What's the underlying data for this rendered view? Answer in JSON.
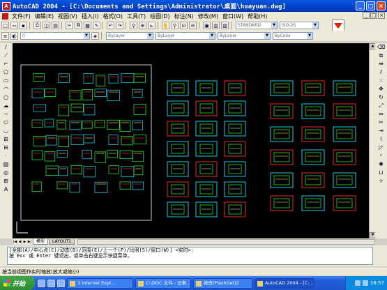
{
  "window": {
    "title": "AutoCAD 2004 - [C:\\Documents and Settings\\Administrator\\桌面\\huayuan.dwg]",
    "app_icon_text": "A",
    "buttons": [
      "_",
      "□",
      "×"
    ]
  },
  "menu": {
    "items": [
      "文件(F)",
      "编辑(E)",
      "视图(V)",
      "插入(I)",
      "格式(O)",
      "工具(T)",
      "绘图(D)",
      "标注(N)",
      "修改(M)",
      "窗口(W)",
      "帮助(H)"
    ],
    "mdi_buttons": [
      "_",
      "□",
      "×"
    ]
  },
  "toolbar": {
    "layer_combo": "0",
    "linetype_combo": "ByLayer",
    "color_combo": "ByLayer",
    "lineweight_combo": "ByLayer",
    "plotstyle_combo": "ByColor",
    "style_combo": "STANDARD",
    "dimstyle_combo": "ISO-25"
  },
  "layout_tabs": [
    "模型",
    "LAYOUT1"
  ],
  "command": {
    "lines": [
      "[全部(A)/中心点(C)/动态(D)/范围(E)/上一个(P)/比例(S)/窗口(W)] <实时>:",
      "按 Esc 或 Enter 键退出，或单击右键显示快捷菜单。"
    ]
  },
  "status": {
    "text": "按当前视图作实时缩放(放大或缩小)"
  },
  "taskbar": {
    "start_label": "开始",
    "tasks": [
      "3 Internet Expl...",
      "C:\\DOC 文件 - 记事...",
      "修改(FlashGet)2",
      "AutoCAD 2004 - [C:..."
    ],
    "clock": "16:57"
  },
  "drawing_colors": {
    "background": "#000000",
    "frame_white": "#ffffff",
    "frame_red": "#ff3030",
    "frame_green": "#30ff30",
    "frame_cyan": "#20e0ff",
    "frame_yellow": "#ffff40"
  }
}
